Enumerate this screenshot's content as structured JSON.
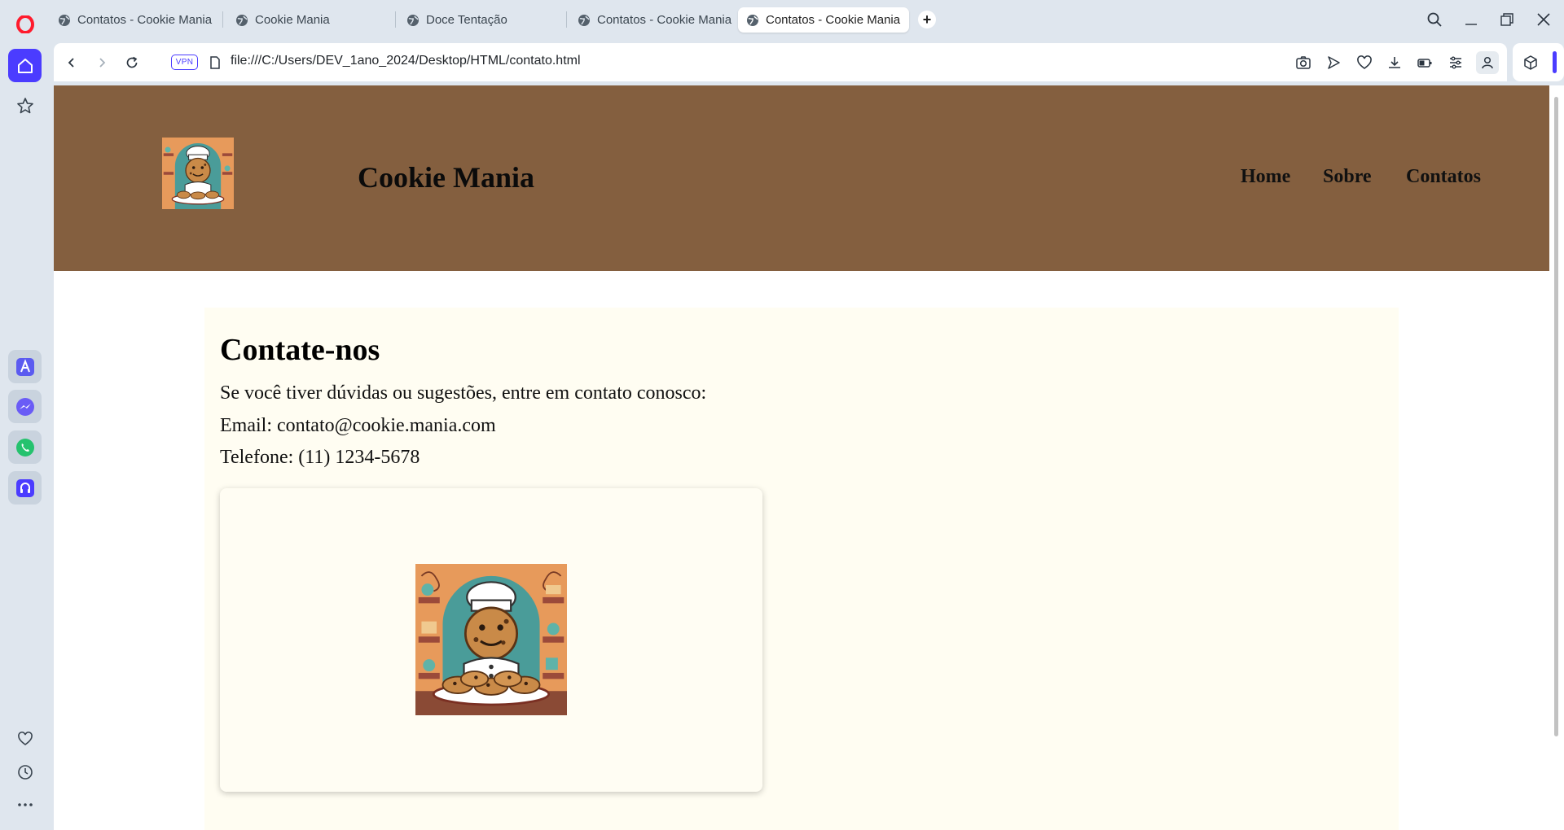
{
  "browser": {
    "tabs": [
      {
        "title": "Contatos - Cookie Mania",
        "active": false
      },
      {
        "title": "Cookie Mania",
        "active": false
      },
      {
        "title": "Doce Tentação",
        "active": false
      },
      {
        "title": "Contatos - Cookie Mania",
        "active": false
      },
      {
        "title": "Contatos - Cookie Mania",
        "active": true
      }
    ],
    "vpn_label": "VPN",
    "url": "file:///C:/Users/DEV_1ano_2024/Desktop/HTML/contato.html",
    "accent_color": "#4b3cff"
  },
  "sidebar": {
    "apps": [
      "aria-icon",
      "messenger-icon",
      "whatsapp-icon",
      "music-player-icon"
    ]
  },
  "site": {
    "header_color": "#845f3f",
    "title": "Cookie Mania",
    "nav": [
      "Home",
      "Sobre",
      "Contatos"
    ],
    "contact": {
      "heading": "Contate-nos",
      "intro": "Se você tiver dúvidas ou sugestões, entre em contato conosco:",
      "email": "Email: contato@cookie.mania.com",
      "phone": "Telefone: (11) 1234-5678"
    }
  }
}
